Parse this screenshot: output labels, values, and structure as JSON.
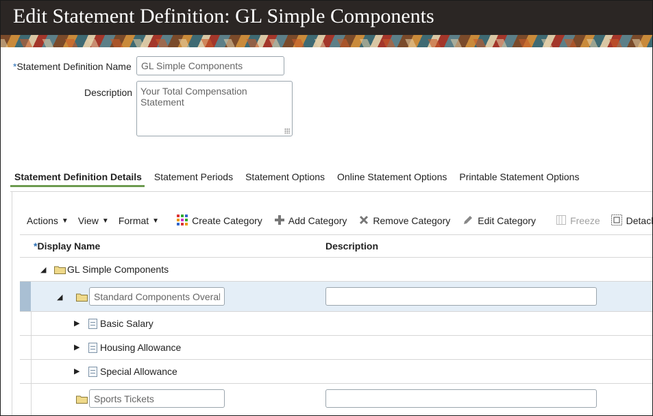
{
  "header": {
    "title": "Edit Statement Definition: GL Simple Components"
  },
  "form": {
    "required_marker": "*",
    "name_label": "Statement Definition Name",
    "name_value": "GL Simple Components",
    "description_label": "Description",
    "description_value": "Your Total Compensation Statement"
  },
  "tabs": [
    {
      "label": "Statement Definition Details",
      "active": true
    },
    {
      "label": "Statement Periods",
      "active": false
    },
    {
      "label": "Statement Options",
      "active": false
    },
    {
      "label": "Online Statement Options",
      "active": false
    },
    {
      "label": "Printable Statement Options",
      "active": false
    }
  ],
  "toolbar": {
    "actions_label": "Actions",
    "view_label": "View",
    "format_label": "Format",
    "create_category_label": "Create Category",
    "add_category_label": "Add Category",
    "remove_category_label": "Remove Category",
    "edit_category_label": "Edit Category",
    "freeze_label": "Freeze",
    "detach_label": "Detach"
  },
  "table": {
    "required_marker": "*",
    "columns": [
      "Display Name",
      "Description"
    ],
    "rows": [
      {
        "display_name": "GL Simple Components",
        "description": "",
        "type": "folder",
        "expanded": true,
        "level": 0
      },
      {
        "display_name": "Standard Components Overall",
        "description": "",
        "type": "folder",
        "expanded": true,
        "level": 1,
        "selected": true
      },
      {
        "display_name": "Basic Salary",
        "description": "",
        "type": "item",
        "expanded": false,
        "level": 2
      },
      {
        "display_name": "Housing Allowance",
        "description": "",
        "type": "item",
        "expanded": false,
        "level": 2
      },
      {
        "display_name": "Special Allowance",
        "description": "",
        "type": "item",
        "expanded": false,
        "level": 2
      },
      {
        "display_name": "Sports Tickets",
        "description": "",
        "type": "folder",
        "expanded": false,
        "level": 1
      }
    ]
  },
  "colors": {
    "banner_bg": "#2b2624",
    "active_tab_underline": "#6c9a4f",
    "selected_row_bg": "#e4eef7",
    "required_marker": "#2a6fb5"
  }
}
